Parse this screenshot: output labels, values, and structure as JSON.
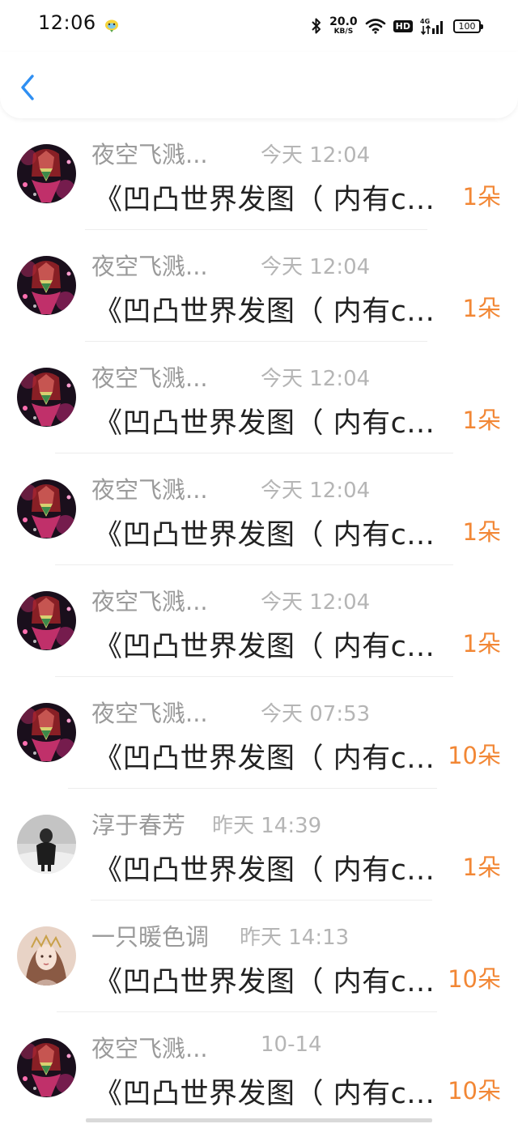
{
  "status_bar": {
    "time": "12:06",
    "net_speed_value": "20.0",
    "net_speed_unit": "KB/S",
    "hd_label": "HD",
    "network_type": "4G",
    "battery": "100",
    "icons": [
      "bluetooth-icon",
      "wifi-icon",
      "signal-icon",
      "battery-icon"
    ]
  },
  "nav": {
    "back_icon": "chevron-left-icon",
    "accent_color": "#2f8ff2"
  },
  "messages": [
    {
      "name": "夜空飞溅...",
      "time": "今天 12:04",
      "text": "《凹凸世界发图（ 内有c...",
      "count": "1朵",
      "avatar": "dark-anime"
    },
    {
      "name": "夜空飞溅...",
      "time": "今天 12:04",
      "text": "《凹凸世界发图（ 内有c...",
      "count": "1朵",
      "avatar": "dark-anime"
    },
    {
      "name": "夜空飞溅...",
      "time": "今天 12:04",
      "text": "《凹凸世界发图（ 内有c...",
      "count": "1朵",
      "avatar": "dark-anime"
    },
    {
      "name": "夜空飞溅...",
      "time": "今天 12:04",
      "text": "《凹凸世界发图（ 内有c...",
      "count": "1朵",
      "avatar": "dark-anime"
    },
    {
      "name": "夜空飞溅...",
      "time": "今天 12:04",
      "text": "《凹凸世界发图（ 内有c...",
      "count": "1朵",
      "avatar": "dark-anime"
    },
    {
      "name": "夜空飞溅...",
      "time": "今天 07:53",
      "text": "《凹凸世界发图（ 内有c...",
      "count": "10朵",
      "avatar": "dark-anime"
    },
    {
      "name": "淳于春芳",
      "time": "昨天 14:39",
      "text": "《凹凸世界发图（ 内有c...",
      "count": "1朵",
      "avatar": "gray-photo"
    },
    {
      "name": "一只暖色调",
      "time": "昨天 14:13",
      "text": "《凹凸世界发图（ 内有c...",
      "count": "10朵",
      "avatar": "warm-portrait"
    },
    {
      "name": "夜空飞溅...",
      "time": "10-14",
      "text": "《凹凸世界发图（ 内有c...",
      "count": "10朵",
      "avatar": "dark-anime"
    }
  ],
  "colors": {
    "count": "#f28735",
    "meta": "#9a9a9a",
    "text": "#222222"
  }
}
